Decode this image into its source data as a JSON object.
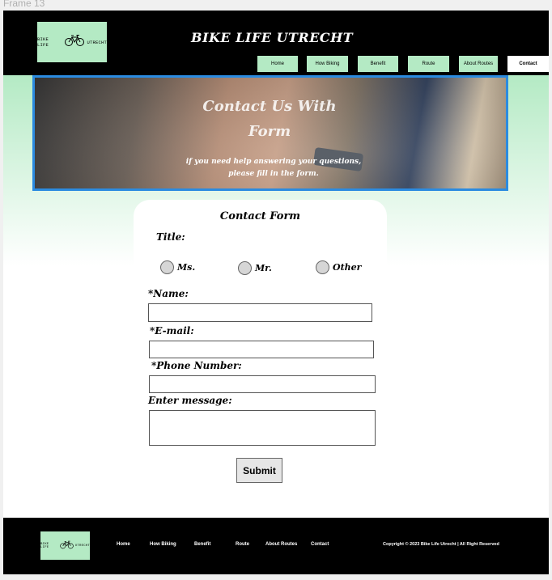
{
  "frame": {
    "label": "Frame 13"
  },
  "header": {
    "logo": {
      "left_text": "BIKE LIFE",
      "right_text": "UTRECHT",
      "icon": "bicycle-icon"
    },
    "title": "BIKE LIFE UTRECHT",
    "nav": [
      "Home",
      "How Biking",
      "Benefit",
      "Route",
      "About Routes",
      "Contact"
    ],
    "active_nav": "Contact"
  },
  "hero": {
    "title": "Contact Us With Form",
    "subtitle": "if you need help answering your questions, please fill in the form."
  },
  "form": {
    "title": "Contact Form",
    "title_label": "Title:",
    "options": [
      "Ms.",
      "Mr.",
      "Other"
    ],
    "name_label": "*Name:",
    "email_label": "*E-mail:",
    "phone_label": "*Phone Number:",
    "message_label": "Enter message:",
    "submit": "Submit",
    "name_value": "",
    "email_value": "",
    "phone_value": "",
    "message_value": ""
  },
  "footer": {
    "logo": {
      "left_text": "BIKE LIFE",
      "right_text": "UTRECHT",
      "icon": "bicycle-icon"
    },
    "links": [
      "Home",
      "How Biking",
      "Benefit",
      "Route",
      "About Routes",
      "Contact"
    ],
    "copyright": "Copyright  © 2023 Bike Life Utrecht | All Right Reserved"
  },
  "colors": {
    "accent": "#b4eac4",
    "header_bg": "#000000",
    "hero_border": "#2b8be0"
  }
}
